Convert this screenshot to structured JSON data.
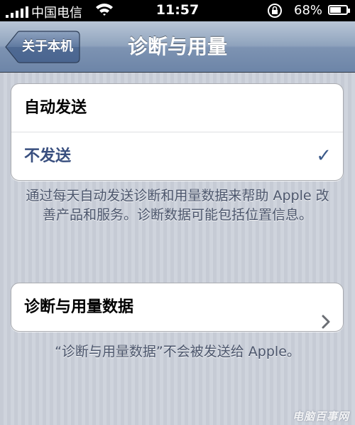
{
  "status_bar": {
    "carrier": "中国电信",
    "time": "11:57",
    "battery_percent": "68%",
    "battery_level": 0.68,
    "icons": [
      "signal-icon",
      "wifi-icon",
      "rotation-lock-icon",
      "battery-icon"
    ]
  },
  "nav": {
    "back_label": "关于本机",
    "title": "诊断与用量"
  },
  "send_options": {
    "items": [
      {
        "label": "自动发送",
        "selected": false
      },
      {
        "label": "不发送",
        "selected": true
      }
    ],
    "checkmark": "✓"
  },
  "send_footer": "通过每天自动发送诊断和用量数据来帮助 Apple 改善产品和服务。诊断数据可能包括位置信息。",
  "data_row": {
    "label": "诊断与用量数据"
  },
  "data_footer": "“诊断与用量数据”不会被发送给 Apple。",
  "watermark": "电脑百事网",
  "colors": {
    "background": "#c6cbd5",
    "nav_bar": "#7d93b2",
    "selected_text": "#394f7f",
    "footer_text": "#4c566c"
  }
}
